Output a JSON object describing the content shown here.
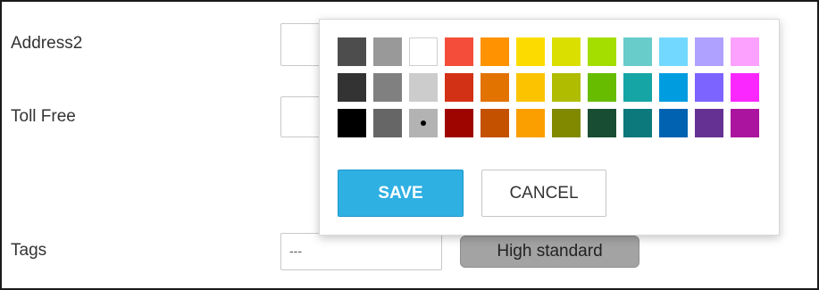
{
  "form": {
    "address2_label": "Address2",
    "toll_free_label": "Toll Free",
    "tags_label": "Tags",
    "tags_value": "---",
    "tag_badge": "High standard"
  },
  "color_picker": {
    "rows": [
      [
        "#4d4d4d",
        "#999999",
        "#ffffff",
        "#f44e3b",
        "#fe9200",
        "#fcdc00",
        "#dbdf00",
        "#a4dd00",
        "#68ccca",
        "#73d8ff",
        "#aea1ff",
        "#fda1ff"
      ],
      [
        "#333333",
        "#808080",
        "#cccccc",
        "#d33115",
        "#e27300",
        "#fcc400",
        "#b0bc00",
        "#68bc00",
        "#16a5a5",
        "#009ce0",
        "#7b64ff",
        "#fa28ff"
      ],
      [
        "#000000",
        "#666666",
        "#b3b3b3",
        "#9f0500",
        "#c45100",
        "#fb9e00",
        "#808900",
        "#194d33",
        "#0c797d",
        "#0062b1",
        "#653294",
        "#ab149e"
      ]
    ],
    "selected": [
      2,
      2
    ],
    "save_label": "SAVE",
    "cancel_label": "CANCEL",
    "accent": "#2fb0e3"
  }
}
